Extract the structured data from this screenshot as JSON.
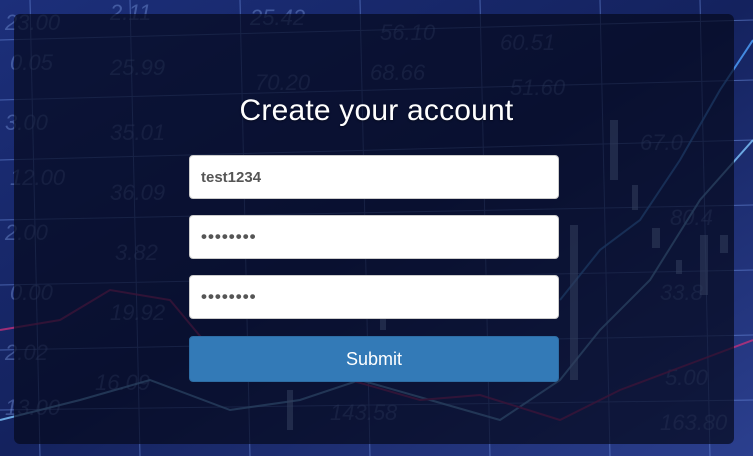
{
  "form": {
    "title": "Create your account",
    "username_value": "test1234",
    "password_value": "••••••••",
    "confirm_password_value": "••••••••",
    "submit_label": "Submit"
  },
  "colors": {
    "submit_button": "#337ab7",
    "panel_overlay": "#060a1e",
    "background": "#1a2a6c"
  }
}
